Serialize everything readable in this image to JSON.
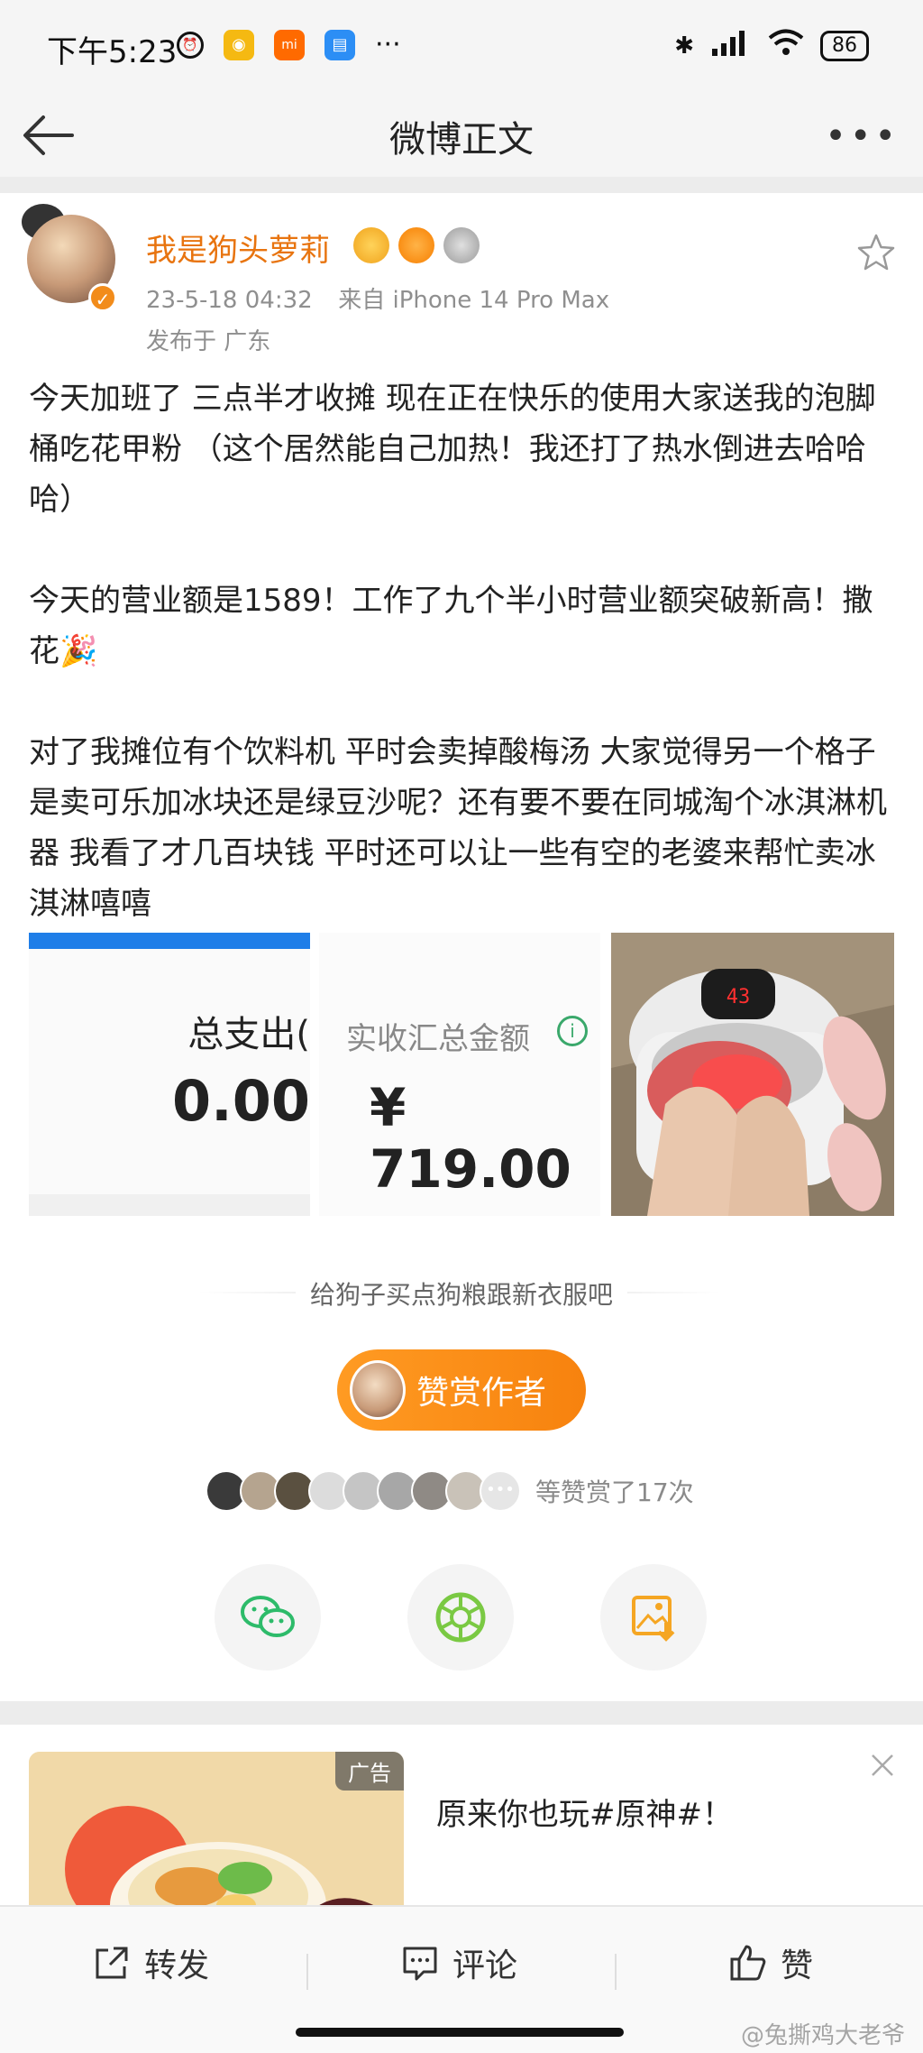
{
  "status_bar": {
    "time": "下午5:23",
    "battery": "86",
    "more": "···"
  },
  "nav": {
    "title": "微博正文"
  },
  "post": {
    "author": "我是狗头萝莉",
    "date": "23-5-18 04:32",
    "source": "来自 iPhone 14 Pro Max",
    "location": "发布于 广东",
    "paragraphs": [
      "今天加班了 三点半才收摊 现在正在快乐的使用大家送我的泡脚桶吃花甲粉 （这个居然能自己加热！我还打了热水倒进去哈哈哈）",
      "今天的营业额是1589！工作了九个半小时营业额突破新高！撒花🎉",
      "对了我摊位有个饮料机 平时会卖掉酸梅汤 大家觉得另一个格子是卖可乐加冰块还是绿豆沙呢？还有要不要在同城淘个冰淇淋机器 我看了才几百块钱 平时还可以让一些有空的老婆来帮忙卖冰淇淋嘻嘻"
    ],
    "image1": {
      "label": "总支出(",
      "value": "0.00"
    },
    "image2": {
      "label": "实收汇总金额",
      "value": "¥ 719.00",
      "info": "i"
    },
    "image3": {
      "display": "43"
    }
  },
  "reward": {
    "prompt": "给狗子买点狗粮跟新衣服吧",
    "button": "赞赏作者",
    "count_text": "等赞赏了17次"
  },
  "ad": {
    "tag": "广告",
    "title": "原来你也玩#原神#！"
  },
  "bottom_bar": {
    "repost": "转发",
    "comment": "评论",
    "like": "赞"
  },
  "watermark": "@兔撕鸡大老爷",
  "colors": {
    "accent_orange": "#f7820e",
    "author_orange": "#e8740f",
    "bar_blue": "#1f7ee8",
    "wechat_green": "#2dbb6a"
  }
}
